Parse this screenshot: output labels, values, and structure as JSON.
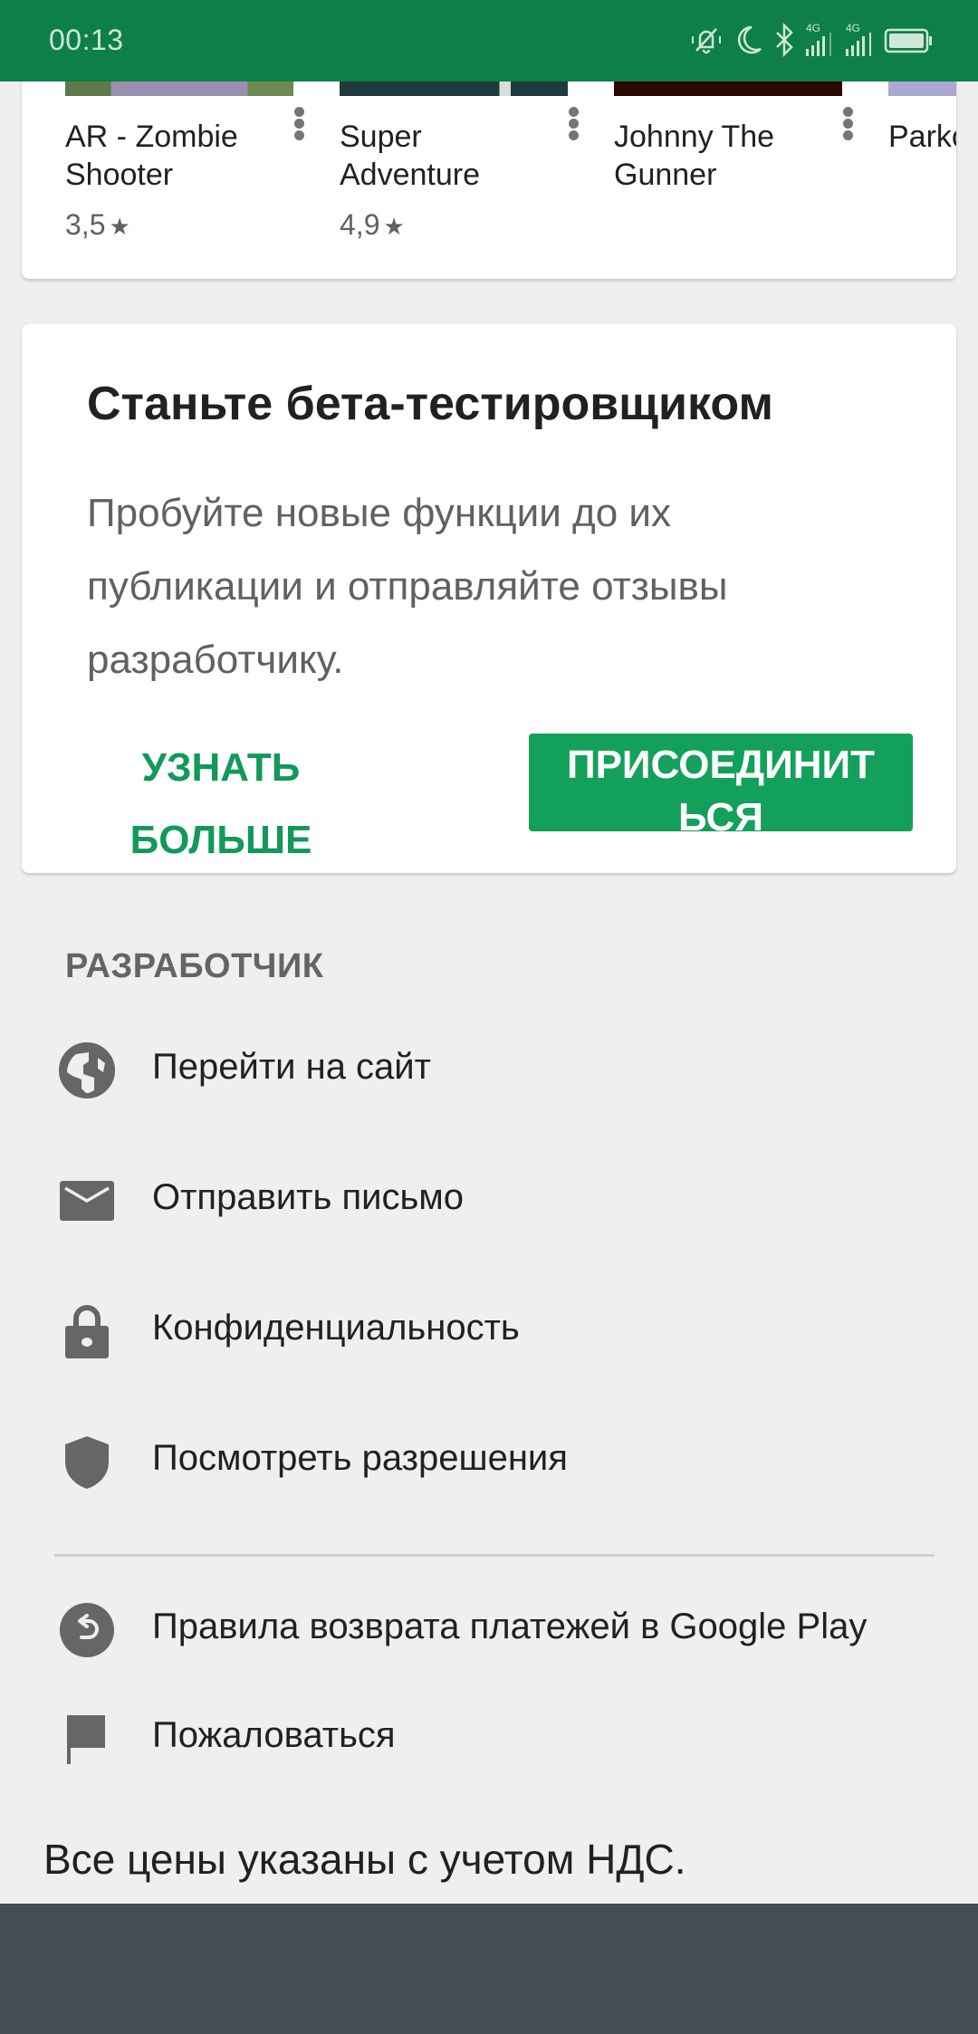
{
  "status_bar": {
    "time": "00:13",
    "icons": [
      "vibrate-bell-off-icon",
      "moon-icon",
      "bluetooth-icon",
      "signal-4g-icon",
      "signal-4g-icon",
      "battery-icon"
    ],
    "network_labels": [
      "4G",
      "4G"
    ]
  },
  "games": [
    {
      "title": "AR - Zombie Shooter",
      "rating": "3,5",
      "star": "★",
      "thumb_color": "#8e7f99"
    },
    {
      "title": "Super Adventure",
      "rating": "4,9",
      "star": "★",
      "thumb_color": "#1f3a3c"
    },
    {
      "title": "Johnny The Gunner",
      "rating": "",
      "star": "",
      "thumb_color": "#2a0700"
    },
    {
      "title": "Parkour Rush",
      "rating": "",
      "star": "",
      "thumb_color": "#aaa8d0"
    }
  ],
  "beta": {
    "title": "Станьте бета-тестировщиком",
    "description": "Пробуйте новые функции до их публикации и отправляйте отзывы разработчику.",
    "learn_more_label": "УЗНАТЬ БОЛЬШЕ",
    "join_label": "ПРИСОЕДИНИТЬСЯ"
  },
  "developer": {
    "section_title": "РАЗРАБОТЧИК",
    "items": [
      {
        "label": "Перейти на сайт",
        "icon": "globe-icon"
      },
      {
        "label": "Отправить письмо",
        "icon": "email-icon"
      },
      {
        "label": "Конфиденциальность",
        "icon": "lock-icon"
      },
      {
        "label": "Посмотреть разрешения",
        "icon": "shield-icon"
      }
    ]
  },
  "extra_items": [
    {
      "label": "Правила возврата платежей в Google Play",
      "icon": "refund-icon"
    },
    {
      "label": "Пожаловаться",
      "icon": "flag-icon"
    }
  ],
  "footer_note": "Все цены указаны с учетом НДС.",
  "colors": {
    "status_bar": "#0e7f48",
    "accent": "#13a05a",
    "background": "#efefef",
    "bottom_bar": "#464c53"
  }
}
